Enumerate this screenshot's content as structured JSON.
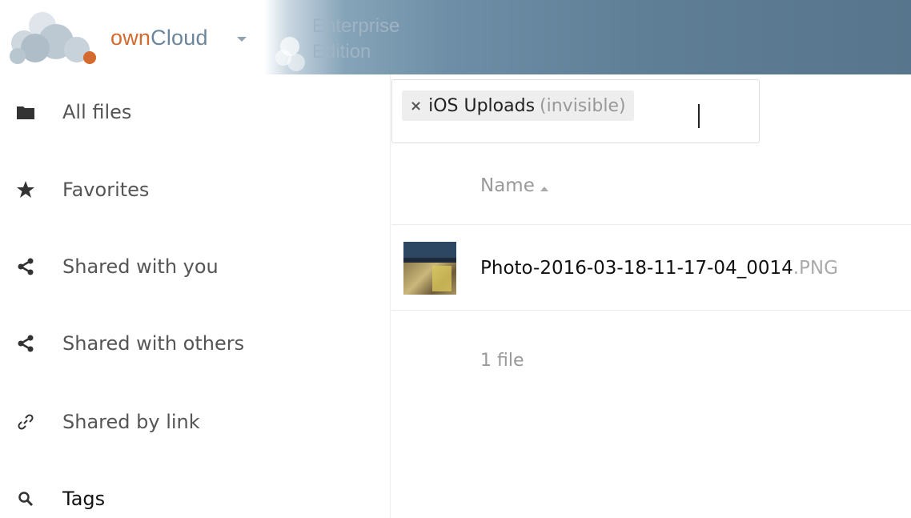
{
  "header": {
    "brand_own": "own",
    "brand_cloud": "Cloud",
    "edition_line1": "Enterprise",
    "edition_line2": "Edition"
  },
  "sidebar": {
    "items": [
      {
        "label": "All files",
        "icon": "folder-icon"
      },
      {
        "label": "Favorites",
        "icon": "star-icon"
      },
      {
        "label": "Shared with you",
        "icon": "share-icon"
      },
      {
        "label": "Shared with others",
        "icon": "share-icon"
      },
      {
        "label": "Shared by link",
        "icon": "link-icon"
      },
      {
        "label": "Tags",
        "icon": "search-icon"
      }
    ]
  },
  "tag_filter": {
    "tag_name": "iOS Uploads",
    "tag_state": "(invisible)",
    "remove_symbol": "×"
  },
  "file_list": {
    "column_name": "Name",
    "files": [
      {
        "basename": "Photo-2016-03-18-11-17-04_0014",
        "extension": ".PNG"
      }
    ],
    "summary": "1 file"
  },
  "colors": {
    "brand_orange": "#d46a2f",
    "brand_blue": "#6b869b",
    "header_dark": "#57758c"
  }
}
